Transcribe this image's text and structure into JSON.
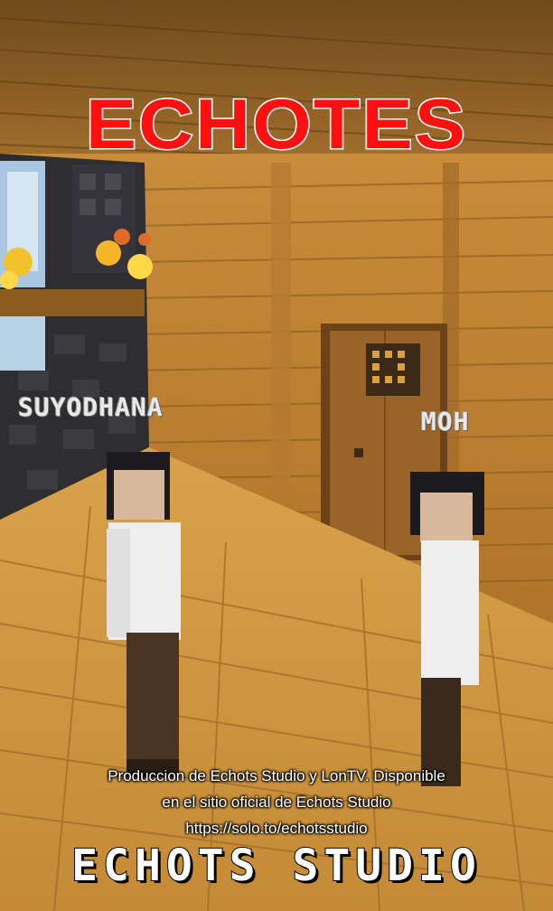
{
  "title": "ECHOTES",
  "characters": [
    {
      "name": "SUYODHANA"
    },
    {
      "name": "MOH"
    }
  ],
  "credits": {
    "line1": "Produccion de Echots Studio y LonTV. Disponible",
    "line2": "en el sitio oficial de Echots Studio",
    "url": "https://solo.to/echotsstudio"
  },
  "studio_logo": "ECHOTS STUDIO",
  "colors": {
    "title": "#ff1010",
    "title_outline": "#ffffff",
    "wood_light": "#d9a24a",
    "wood_dark": "#8a5a1e"
  }
}
